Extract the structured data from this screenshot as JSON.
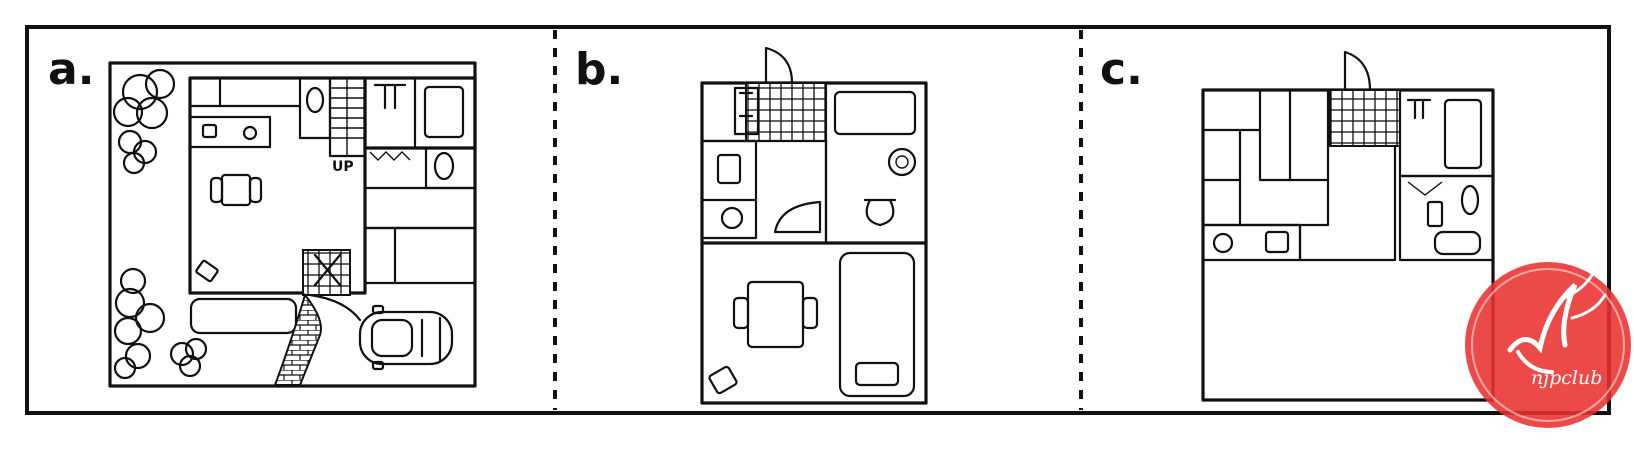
{
  "panels": [
    {
      "label": "a.",
      "annotation": "UP"
    },
    {
      "label": "b."
    },
    {
      "label": "c."
    }
  ],
  "watermark": {
    "text": "njpclub",
    "color": "#e8312f"
  }
}
